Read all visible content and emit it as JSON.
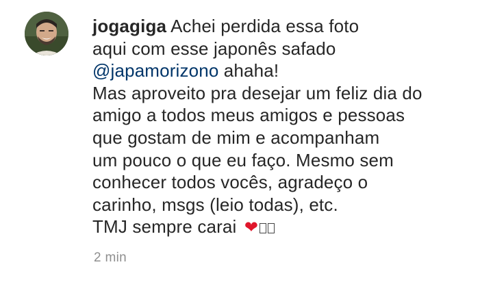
{
  "comment": {
    "username": "jogagiga",
    "lines": [
      "Achei perdida essa foto",
      "aqui com esse japonês safado",
      "Mas aproveito pra desejar um feliz dia do",
      "amigo a todos meus amigos e pessoas",
      "que gostam de mim e acompanham",
      "um pouco o que eu faço. Mesmo sem",
      "conhecer todos vocês, agradeço o",
      "carinho, msgs (leio todas), etc."
    ],
    "mention": "@japamorizono",
    "after_mention": " ahaha!",
    "last_line_text": "TMJ sempre carai ",
    "last_line_emoji": [
      "heart-icon",
      "unsupported-emoji-icon",
      "unsupported-emoji-icon"
    ],
    "timestamp": "2 min"
  },
  "colors": {
    "text": "#262626",
    "mention": "#003569",
    "timestamp": "#8e8e8e",
    "heart": "#e0162b"
  }
}
